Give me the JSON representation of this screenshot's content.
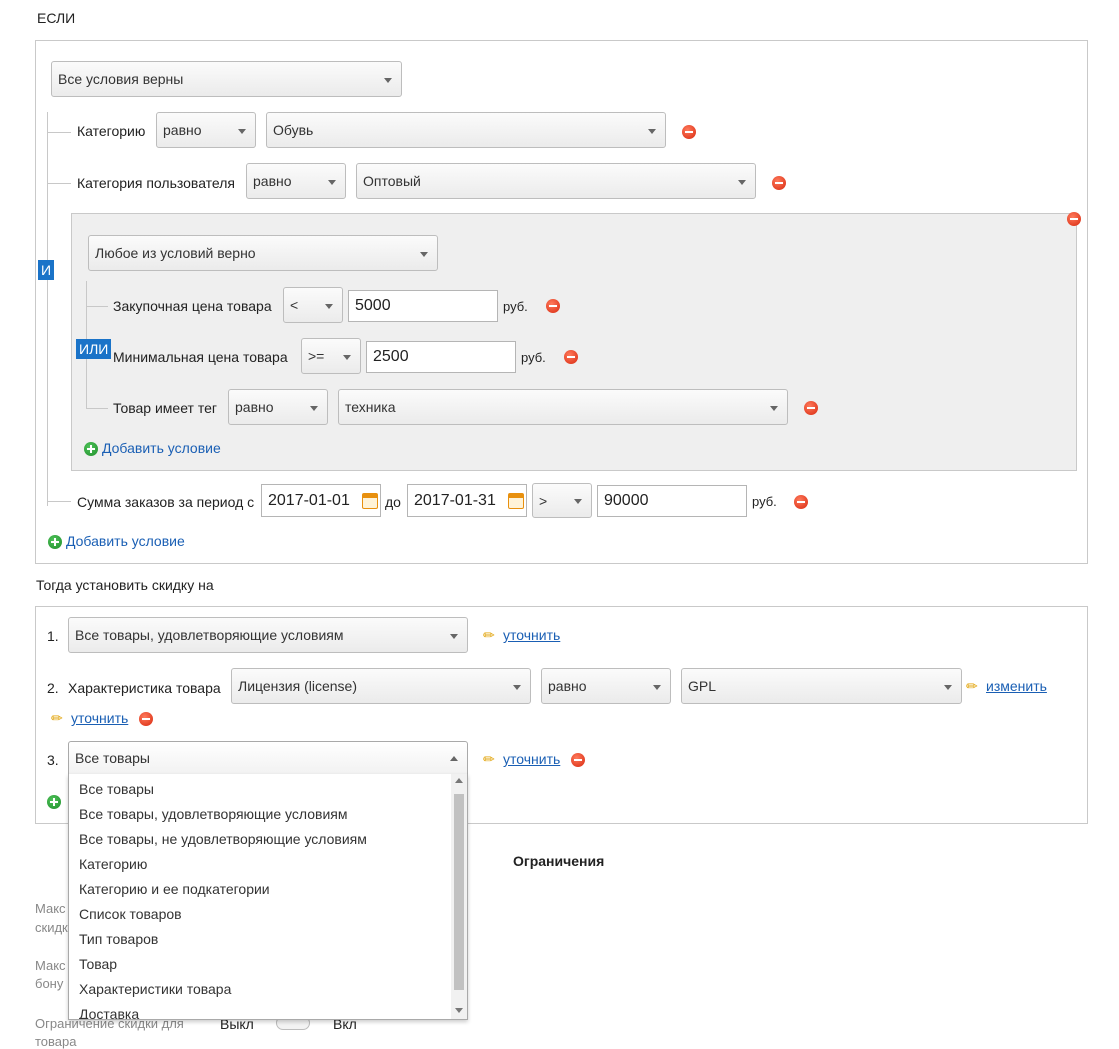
{
  "if_section": {
    "title": "ЕСЛИ",
    "main_mode": "Все условия верны",
    "and_badge": "И",
    "conditions": [
      {
        "label": "Категорию",
        "operator": "равно",
        "value": "Обувь"
      },
      {
        "label": "Категория пользователя",
        "operator": "равно",
        "value": "Оптовый"
      }
    ],
    "group": {
      "mode": "Любое из условий верно",
      "or_badge": "ИЛИ",
      "rows": [
        {
          "label": "Закупочная цена товара",
          "operator": "<",
          "value": "5000",
          "unit": "руб."
        },
        {
          "label": "Минимальная цена товара",
          "operator": ">=",
          "value": "2500",
          "unit": "руб."
        },
        {
          "label": "Товар имеет тег",
          "operator": "равно",
          "value": "техника"
        }
      ],
      "add_label": "Добавить условие"
    },
    "sum_condition": {
      "label": "Сумма заказов за период с",
      "date_from": "2017-01-01",
      "to_label": "до",
      "date_to": "2017-01-31",
      "operator": ">",
      "value": "90000",
      "unit": "руб."
    },
    "add_label": "Добавить условие"
  },
  "then_section": {
    "title": "Тогда установить скидку на",
    "rows": [
      {
        "num": "1.",
        "select": "Все товары, удовлетворяющие условиям",
        "link": "уточнить"
      },
      {
        "num": "2.",
        "label": "Характеристика товара",
        "feature": "Лицензия (license)",
        "operator": "равно",
        "value": "GPL",
        "change_link": "изменить",
        "link": "уточнить"
      },
      {
        "num": "3.",
        "select": "Все товары",
        "link": "уточнить"
      }
    ],
    "dropdown_options": [
      "Все товары",
      "Все товары, удовлетворяющие условиям",
      "Все товары, не удовлетворяющие условиям",
      "Категорию",
      "Категорию и ее подкатегории",
      "Список товаров",
      "Тип товаров",
      "Товар",
      "Характеристики товара",
      "Доставка"
    ]
  },
  "limits": {
    "title": "Ограничения",
    "row1_fragment_a": "Макс",
    "row1_fragment_b": "скидк",
    "row2_fragment_a": "Макс",
    "row2_fragment_b": "бону",
    "row3_label_a": "Ограничение скидки для",
    "row3_label_b": "товара",
    "toggle_off": "Выкл",
    "toggle_on": "Вкл"
  },
  "colors": {
    "accent_badge": "#1a73c8",
    "link": "#1a5fb4",
    "remove": "#d8290f",
    "add": "#1f8f2b"
  }
}
